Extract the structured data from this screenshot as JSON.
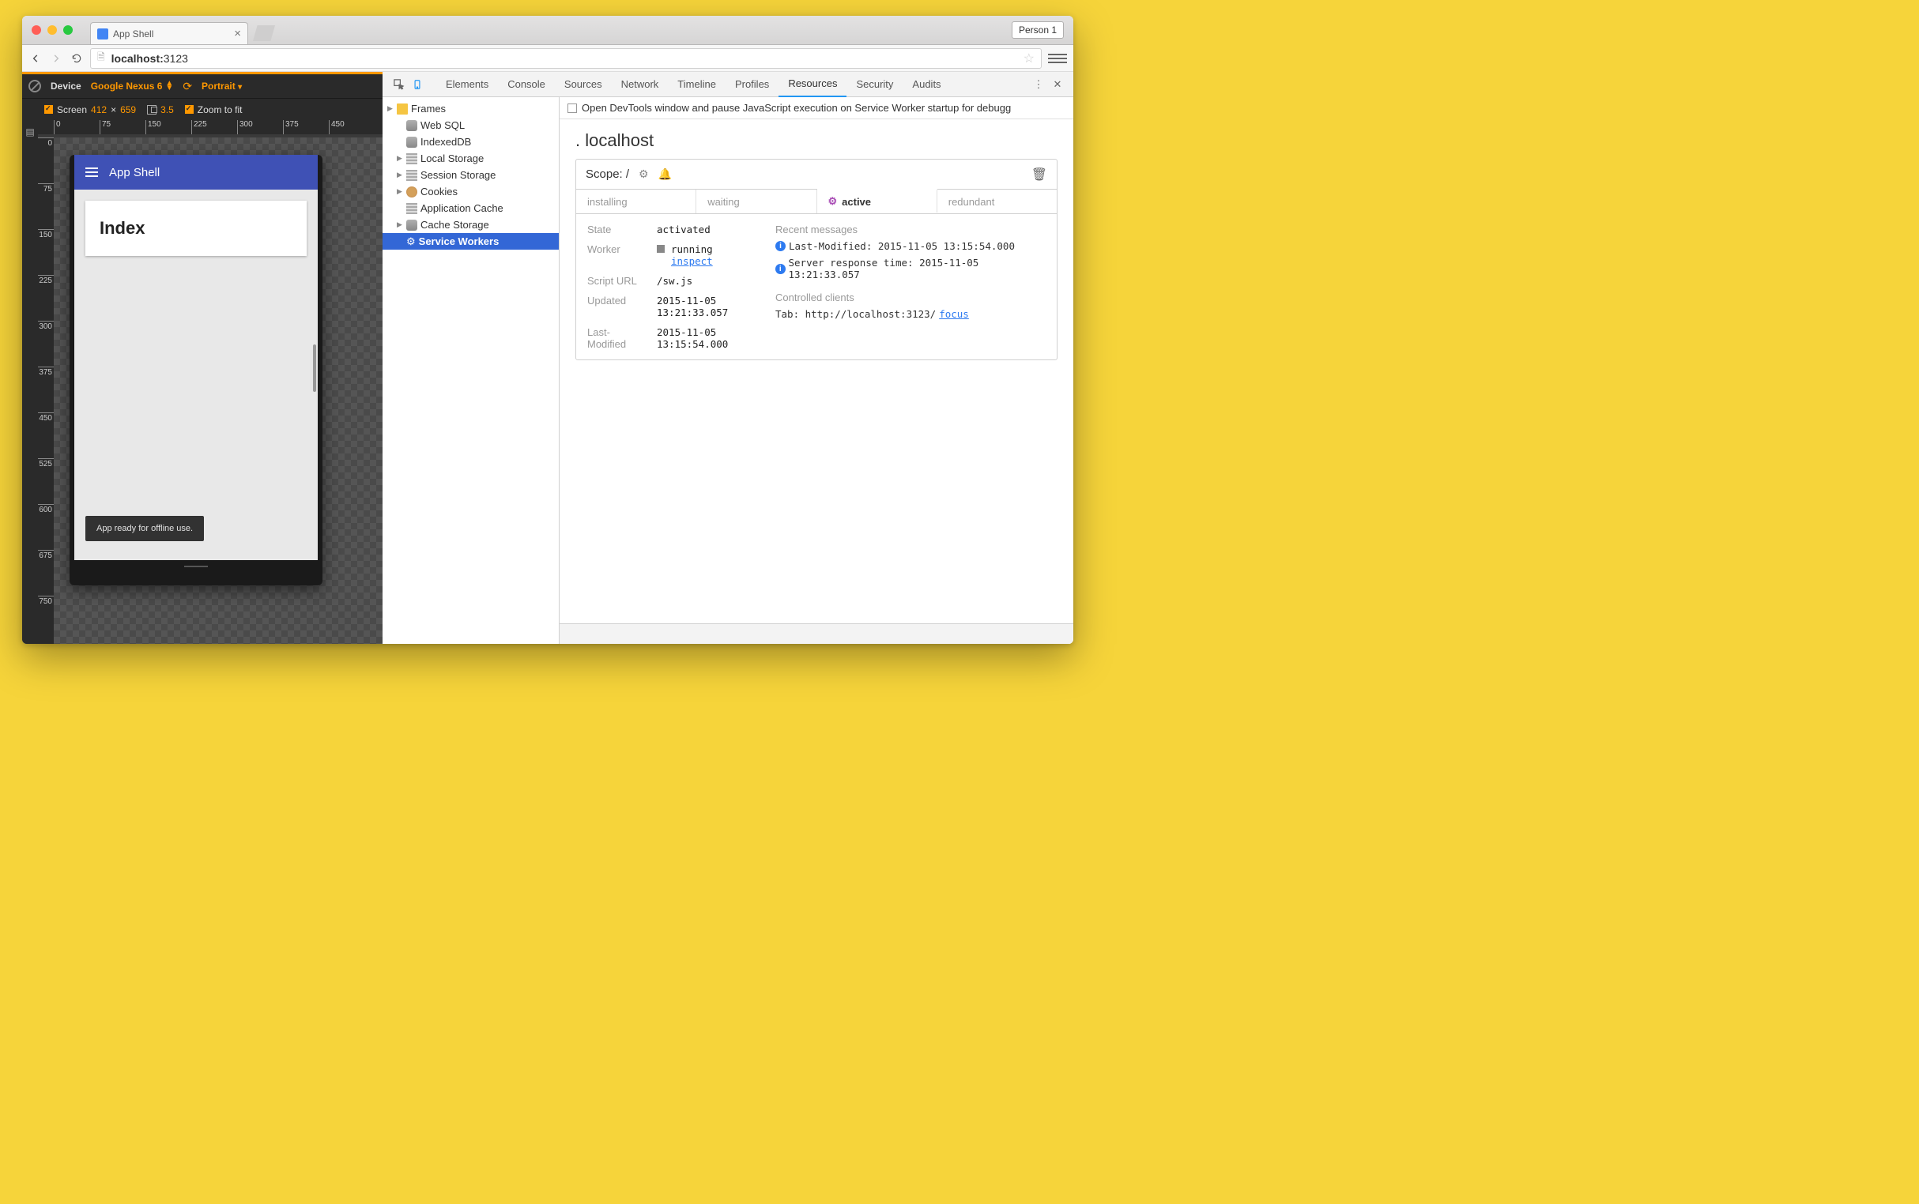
{
  "chrome": {
    "tab_title": "App Shell",
    "person": "Person 1",
    "url_host": "localhost:",
    "url_port": "3123"
  },
  "device": {
    "label": "Device",
    "name": "Google Nexus 6",
    "orientation": "Portrait",
    "screen_label": "Screen",
    "width": "412",
    "times": "×",
    "height": "659",
    "dpr": "3.5",
    "zoom_label": "Zoom to fit",
    "ruler_h": [
      "0",
      "75",
      "150",
      "225",
      "300",
      "375",
      "450"
    ],
    "ruler_v": [
      "0",
      "75",
      "150",
      "225",
      "300",
      "375",
      "450",
      "525",
      "600",
      "675",
      "750"
    ]
  },
  "app": {
    "title": "App Shell",
    "card_heading": "Index",
    "toast": "App ready for offline use."
  },
  "devtools": {
    "tabs": [
      "Elements",
      "Console",
      "Sources",
      "Network",
      "Timeline",
      "Profiles",
      "Resources",
      "Security",
      "Audits"
    ],
    "active_tab": "Resources",
    "resources": [
      "Frames",
      "Web SQL",
      "IndexedDB",
      "Local Storage",
      "Session Storage",
      "Cookies",
      "Application Cache",
      "Cache Storage",
      "Service Workers"
    ],
    "selected_resource": "Service Workers",
    "sw_pause_label": "Open DevTools window and pause JavaScript execution on Service Worker startup for debugg",
    "sw_host": "localhost",
    "scope_label": "Scope: /",
    "status_tabs": [
      "installing",
      "waiting",
      "active",
      "redundant"
    ],
    "active_status_tab": "active",
    "details": {
      "state_label": "State",
      "state": "activated",
      "worker_label": "Worker",
      "worker_status": "running",
      "worker_inspect": "inspect",
      "script_label": "Script URL",
      "script": "/sw.js",
      "updated_label": "Updated",
      "updated": "2015-11-05 13:21:33.057",
      "modified_label": "Last-Modified",
      "modified": "2015-11-05 13:15:54.000",
      "recent_label": "Recent messages",
      "recent1": "Last-Modified: 2015-11-05 13:15:54.000",
      "recent2": "Server response time: 2015-11-05 13:21:33.057",
      "clients_label": "Controlled clients",
      "client_prefix": "Tab: http://localhost:3123/ ",
      "client_link": "focus"
    }
  }
}
